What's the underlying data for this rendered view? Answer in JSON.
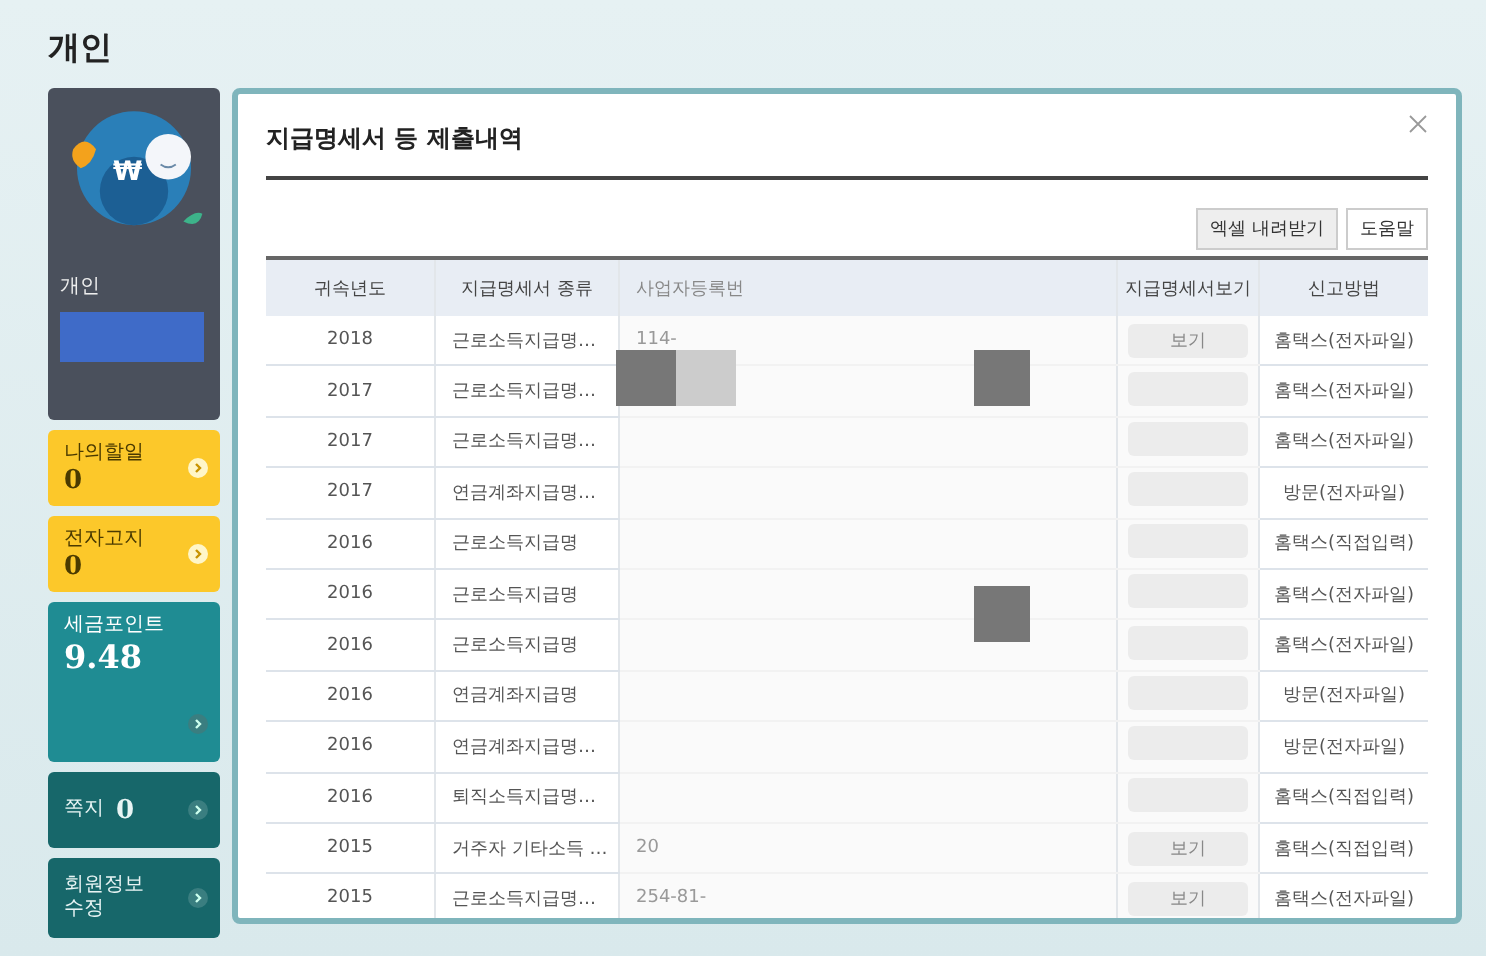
{
  "page_title": "개인",
  "sidebar": {
    "profile": {
      "coin_symbol": "₩",
      "label": "개인"
    },
    "cards": [
      {
        "kind": "yellow",
        "label": "나의할일",
        "value": "0"
      },
      {
        "kind": "yellow",
        "label": "전자고지",
        "value": "0"
      },
      {
        "kind": "point",
        "label": "세금포인트",
        "value": "9.48"
      },
      {
        "kind": "inline",
        "label": "쪽지",
        "value": "0"
      },
      {
        "kind": "teal",
        "label": "회원정보\n수정"
      }
    ]
  },
  "modal": {
    "title": "지급명세서 등 제출내역",
    "buttons": [
      "엑셀 내려받기",
      "도움말"
    ],
    "table": {
      "columns": [
        "귀속년도",
        "지급명세서 종류",
        "사업자등록번",
        "지급명세서보기",
        "신고방법"
      ],
      "rows": [
        {
          "year": "2018",
          "type": "근로소득지급명…",
          "number": "114-",
          "view": "보기",
          "method": "홈택스(전자파일)"
        },
        {
          "year": "2017",
          "type": "근로소득지급명…",
          "method": "홈택스(전자파일)"
        },
        {
          "year": "2017",
          "type": "근로소득지급명…",
          "method": "홈택스(전자파일)"
        },
        {
          "year": "2017",
          "type": "연금계좌지급명…",
          "method": "방문(전자파일)"
        },
        {
          "year": "2016",
          "type": "근로소득지급명",
          "method": "홈택스(직접입력)"
        },
        {
          "year": "2016",
          "type": "근로소득지급명",
          "method": "홈택스(전자파일)"
        },
        {
          "year": "2016",
          "type": "근로소득지급명",
          "method": "홈택스(전자파일)"
        },
        {
          "year": "2016",
          "type": "연금계좌지급명",
          "method": "방문(전자파일)"
        },
        {
          "year": "2016",
          "type": "연금계좌지급명…",
          "method": "방문(전자파일)"
        },
        {
          "year": "2016",
          "type": "퇴직소득지급명…",
          "method": "홈택스(직접입력)"
        },
        {
          "year": "2015",
          "type": "거주자 기타소득 …",
          "number": "20",
          "view": "보기",
          "method": "홈택스(직접입력)"
        },
        {
          "year": "2015",
          "type": "근로소득지급명…",
          "number": "254-81-",
          "view": "보기",
          "method": "홈택스(전자파일)"
        }
      ]
    }
  }
}
